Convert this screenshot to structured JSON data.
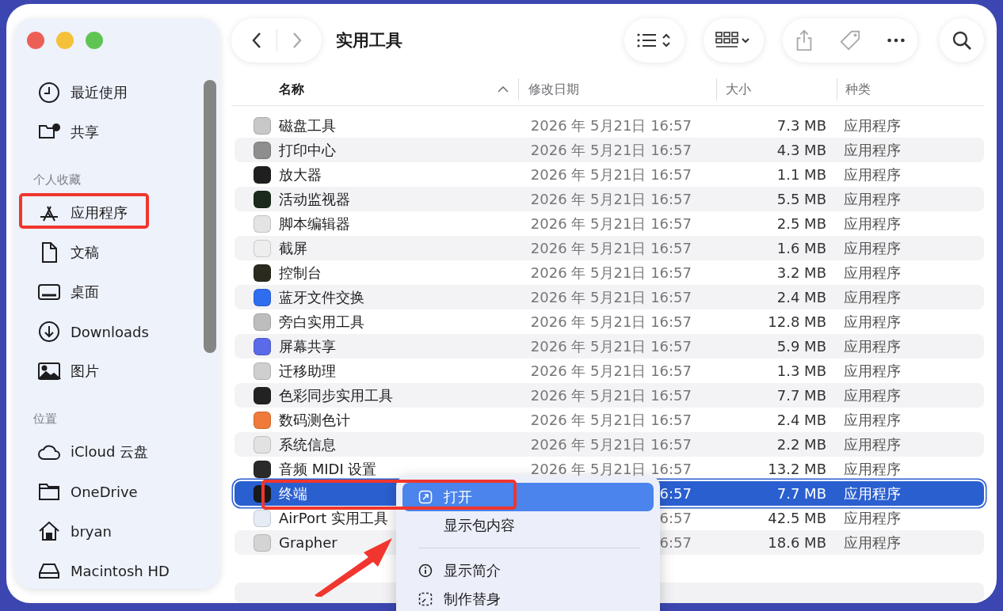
{
  "window": {
    "title": "实用工具"
  },
  "sidebar": {
    "sections": [
      {
        "items": [
          {
            "label": "最近使用",
            "kind": "clock",
            "highlighted": false
          },
          {
            "label": "共享",
            "kind": "shared",
            "highlighted": false
          }
        ]
      },
      {
        "title": "个人收藏",
        "items": [
          {
            "label": "应用程序",
            "kind": "apps",
            "highlighted": true
          },
          {
            "label": "文稿",
            "kind": "doc",
            "highlighted": false
          },
          {
            "label": "桌面",
            "kind": "desktop",
            "highlighted": false
          },
          {
            "label": "Downloads",
            "kind": "download",
            "highlighted": false
          },
          {
            "label": "图片",
            "kind": "photo",
            "highlighted": false
          }
        ]
      },
      {
        "title": "位置",
        "items": [
          {
            "label": "iCloud 云盘",
            "kind": "cloud",
            "highlighted": false
          },
          {
            "label": "OneDrive",
            "kind": "folder",
            "highlighted": false
          },
          {
            "label": "bryan",
            "kind": "home",
            "highlighted": false
          },
          {
            "label": "Macintosh HD",
            "kind": "disk",
            "highlighted": false
          }
        ]
      }
    ]
  },
  "table": {
    "columns": [
      {
        "label": "名称",
        "sorted": true
      },
      {
        "label": "修改日期",
        "sorted": false
      },
      {
        "label": "大小",
        "sorted": false
      },
      {
        "label": "种类",
        "sorted": false
      }
    ],
    "rows": [
      {
        "name": "磁盘工具",
        "date": "2026 年 5月21日 16:57",
        "size": "7.3 MB",
        "kind": "应用程序",
        "color": "#c8c8c8",
        "selected": false
      },
      {
        "name": "打印中心",
        "date": "2026 年 5月21日 16:57",
        "size": "4.3 MB",
        "kind": "应用程序",
        "color": "#8e8e8e",
        "selected": false
      },
      {
        "name": "放大器",
        "date": "2026 年 5月21日 16:57",
        "size": "1.1 MB",
        "kind": "应用程序",
        "color": "#1f1f1f",
        "selected": false
      },
      {
        "name": "活动监视器",
        "date": "2026 年 5月21日 16:57",
        "size": "5.5 MB",
        "kind": "应用程序",
        "color": "#1b2a1b",
        "selected": false
      },
      {
        "name": "脚本编辑器",
        "date": "2026 年 5月21日 16:57",
        "size": "2.5 MB",
        "kind": "应用程序",
        "color": "#e4e4e4",
        "selected": false
      },
      {
        "name": "截屏",
        "date": "2026 年 5月21日 16:57",
        "size": "1.6 MB",
        "kind": "应用程序",
        "color": "#eeeeee",
        "selected": false
      },
      {
        "name": "控制台",
        "date": "2026 年 5月21日 16:57",
        "size": "3.2 MB",
        "kind": "应用程序",
        "color": "#2a2a1e",
        "selected": false
      },
      {
        "name": "蓝牙文件交换",
        "date": "2026 年 5月21日 16:57",
        "size": "2.4 MB",
        "kind": "应用程序",
        "color": "#2f6df0",
        "selected": false
      },
      {
        "name": "旁白实用工具",
        "date": "2026 年 5月21日 16:57",
        "size": "12.8 MB",
        "kind": "应用程序",
        "color": "#bdbdbd",
        "selected": false
      },
      {
        "name": "屏幕共享",
        "date": "2026 年 5月21日 16:57",
        "size": "5.9 MB",
        "kind": "应用程序",
        "color": "#5a6ae8",
        "selected": false
      },
      {
        "name": "迁移助理",
        "date": "2026 年 5月21日 16:57",
        "size": "1.3 MB",
        "kind": "应用程序",
        "color": "#cfcfcf",
        "selected": false
      },
      {
        "name": "色彩同步实用工具",
        "date": "2026 年 5月21日 16:57",
        "size": "7.7 MB",
        "kind": "应用程序",
        "color": "#222222",
        "selected": false
      },
      {
        "name": "数码测色计",
        "date": "2026 年 5月21日 16:57",
        "size": "2.4 MB",
        "kind": "应用程序",
        "color": "#f07a3a",
        "selected": false
      },
      {
        "name": "系统信息",
        "date": "2026 年 5月21日 16:57",
        "size": "2.2 MB",
        "kind": "应用程序",
        "color": "#e2e2e2",
        "selected": false
      },
      {
        "name": "音频 MIDI 设置",
        "date": "2026 年 5月21日 16:57",
        "size": "13.2 MB",
        "kind": "应用程序",
        "color": "#2a2a2a",
        "selected": false
      },
      {
        "name": "终端",
        "date": "6:57",
        "size": "7.7 MB",
        "kind": "应用程序",
        "color": "#1a1a1a",
        "selected": true
      },
      {
        "name": "AirPort 实用工具",
        "date": "6:57",
        "size": "42.5 MB",
        "kind": "应用程序",
        "color": "#e6ecf6",
        "selected": false
      },
      {
        "name": "Grapher",
        "date": "6:57",
        "size": "18.6 MB",
        "kind": "应用程序",
        "color": "#d4d4d4",
        "selected": false
      }
    ]
  },
  "context_menu": {
    "items": [
      {
        "label": "打开",
        "kind": "open",
        "selected": true,
        "highlighted": true
      },
      {
        "label": "显示包内容",
        "kind": "plain",
        "selected": false,
        "highlighted": false
      },
      {
        "kind": "divider"
      },
      {
        "label": "显示简介",
        "kind": "info",
        "selected": false,
        "highlighted": false
      },
      {
        "label": "制作替身",
        "kind": "alias",
        "selected": false,
        "highlighted": false
      }
    ]
  },
  "annotation_arrow": true
}
